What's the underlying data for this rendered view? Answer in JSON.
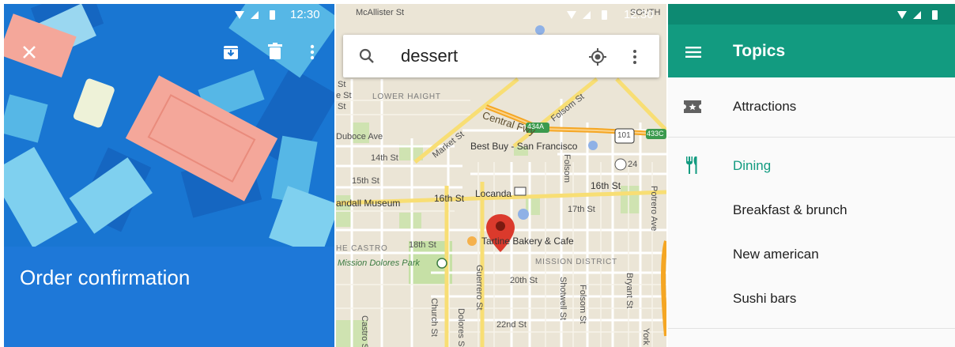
{
  "colors": {
    "order_hero": "#1976d2",
    "order_bottom": "#1e78d8",
    "topics_appbar": "#129b80",
    "topics_status": "#0d8a72",
    "accent_teal": "#129b80",
    "map_marker": "#db3a2c"
  },
  "order_panel": {
    "status_time": "12:30",
    "title": "Order confirmation",
    "icons": [
      "close-icon",
      "archive-icon",
      "delete-icon",
      "more-vert-icon"
    ]
  },
  "map_panel": {
    "status_time": "12:30",
    "search": {
      "query": "dessert",
      "icons": [
        "search-icon",
        "my-location-icon",
        "more-vert-icon"
      ]
    },
    "labels": {
      "mcallister": "McAllister St",
      "south": "SOUTH",
      "lower_haight": "LOWER HAIGHT",
      "central_fwy": "Central Fwy",
      "fwy_shield_434a": "434A",
      "fwy_shield_101": "101",
      "fwy_shield_433c": "433C",
      "market_st": "Market St",
      "folsom_st_top": "Folsom St",
      "duboce_ave": "Duboce Ave",
      "best_buy": "Best Buy - San Francisco",
      "fourteenth": "14th St",
      "fifteenth": "15th St",
      "sixteenth_left": "16th St",
      "sixteenth_right": "16th St",
      "locanda": "Locanda",
      "seventeenth": "17th St",
      "folsom_mid": "Folsom",
      "potrero": "Potrero Ave",
      "randall": "andall Museum",
      "num_24": "24",
      "castro_district": "HE CASTRO",
      "eighteenth": "18th St",
      "tartine": "Tartine Bakery & Cafe",
      "mission_dolores": "Mission Dolores Park",
      "mission_district": "MISSION DISTRICT",
      "twentieth": "20th St",
      "guerrero": "Guerrero St",
      "shotwell": "Shotwell St",
      "folsom_bottom": "Folsom St",
      "bryant": "Bryant St",
      "church": "Church St",
      "dolores": "Dolores St",
      "castro_st": "Castro St",
      "twentysecond": "22nd St",
      "york": "York",
      "st1": "St",
      "st2": "e St",
      "st3": "St"
    }
  },
  "topics_panel": {
    "title": "Topics",
    "items": [
      {
        "label": "Attractions",
        "icon": "ticket-icon",
        "active": false
      },
      {
        "label": "Dining",
        "icon": "restaurant-icon",
        "active": true
      },
      {
        "label": "Breakfast & brunch",
        "active": false
      },
      {
        "label": "New american",
        "active": false
      },
      {
        "label": "Sushi bars",
        "active": false
      }
    ]
  }
}
